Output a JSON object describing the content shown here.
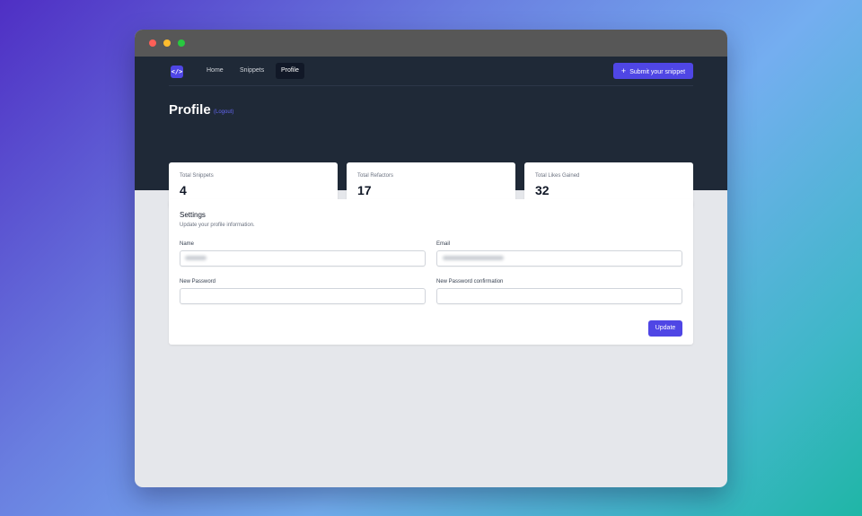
{
  "window": {
    "controls": [
      "close-dot",
      "minimize-dot",
      "maximize-dot"
    ]
  },
  "nav": {
    "logo_glyph": "</>",
    "links": [
      {
        "label": "Home",
        "active": false
      },
      {
        "label": "Snippets",
        "active": false
      },
      {
        "label": "Profile",
        "active": true
      }
    ],
    "submit_plus": "+",
    "submit_label": "Submit your snippet"
  },
  "header": {
    "title": "Profile",
    "logout_label": "(Logout)"
  },
  "stats": [
    {
      "label": "Total Snippets",
      "value": "4"
    },
    {
      "label": "Total Refactors",
      "value": "17"
    },
    {
      "label": "Total Likes Gained",
      "value": "32"
    }
  ],
  "settings": {
    "title": "Settings",
    "subtitle": "Update your profile information.",
    "fields": {
      "name": {
        "label": "Name",
        "value": ""
      },
      "email": {
        "label": "Email",
        "value": ""
      },
      "new_password": {
        "label": "New Password",
        "value": ""
      },
      "password_confirmation": {
        "label": "New Password confirmation",
        "value": ""
      }
    },
    "update_label": "Update"
  },
  "colors": {
    "accent": "#4f46e5",
    "header_bg": "#1f2937",
    "page_bg": "#e5e7eb",
    "logout_link": "#6366f1"
  }
}
